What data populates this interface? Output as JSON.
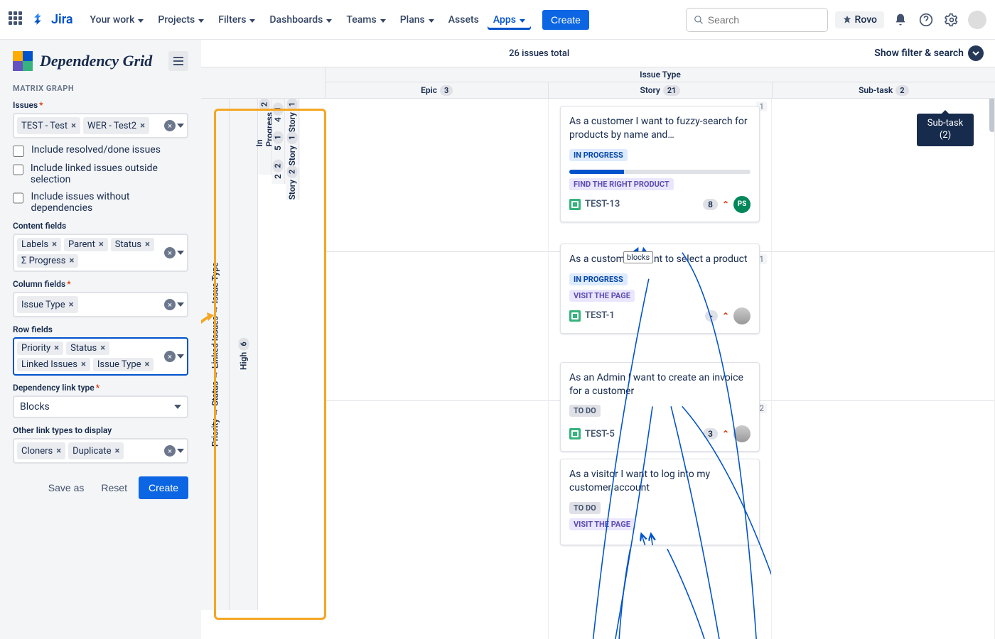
{
  "nav": {
    "logo": "Jira",
    "items": [
      "Your work",
      "Projects",
      "Filters",
      "Dashboards",
      "Teams",
      "Plans",
      "Assets",
      "Apps"
    ],
    "create": "Create",
    "search_placeholder": "Search",
    "rovo": "Rovo"
  },
  "sidebar": {
    "app_title": "Dependency Grid",
    "section": "MATRIX GRAPH",
    "issues_label": "Issues",
    "issues_tags": [
      "TEST - Test",
      "WER - Test2"
    ],
    "chk1": "Include resolved/done issues",
    "chk2": "Include linked issues outside selection",
    "chk3": "Include issues without dependencies",
    "content_label": "Content fields",
    "content_tags": [
      "Labels",
      "Parent",
      "Status",
      "Σ Progress"
    ],
    "col_label": "Column fields",
    "col_tags": [
      "Issue Type"
    ],
    "row_label": "Row fields",
    "row_tags": [
      "Priority",
      "Status",
      "Linked Issues",
      "Issue Type"
    ],
    "dep_label": "Dependency link type",
    "dep_value": "Blocks",
    "other_label": "Other link types to display",
    "other_tags": [
      "Cloners",
      "Duplicate"
    ],
    "save_as": "Save as",
    "reset": "Reset",
    "create": "Create"
  },
  "grid": {
    "total": "26 issues total",
    "filter_toggle": "Show filter & search",
    "col_axis": "Issue Type",
    "columns": [
      {
        "name": "Epic",
        "count": "3"
      },
      {
        "name": "Story",
        "count": "21"
      },
      {
        "name": "Sub-task",
        "count": "2"
      }
    ],
    "row_axis": "Priority → Status → Linked Issues → Issue Type",
    "rows": {
      "priority": {
        "name": "High",
        "count": "6"
      },
      "status": {
        "name": "In Progress",
        "count": "2"
      },
      "cells": [
        {
          "linked": "4",
          "linked_count": "1",
          "type": "Story",
          "type_count": "1"
        },
        {
          "linked": "5",
          "linked_count": "1",
          "type": "Story",
          "type_count": "1"
        },
        {
          "linked": "2",
          "linked_count": "2",
          "type": "Story",
          "type_count": "2"
        }
      ]
    },
    "link_label": "blocks",
    "tooltip": "Sub-task (2)",
    "col_counts": [
      "1",
      "1",
      "2"
    ],
    "cards": [
      {
        "title": "As a customer I want to fuzzy-search for products by name and…",
        "status": "IN PROGRESS",
        "status_class": "",
        "label": "FIND THE RIGHT PRODUCT",
        "key": "TEST-13",
        "pts": "8",
        "avatar": "PS",
        "has_progress": true
      },
      {
        "title": "As a customer I want to select a product",
        "status": "IN PROGRESS",
        "status_class": "",
        "label": "VISIT THE PAGE",
        "key": "TEST-1",
        "pts": "-",
        "avatar": "",
        "has_progress": false
      },
      {
        "title": "As an Admin I want to create an invoice for a customer",
        "status": "TO DO",
        "status_class": "todo",
        "label": "",
        "key": "TEST-5",
        "pts": "3",
        "avatar": "",
        "has_progress": false
      },
      {
        "title": "As a visitor I want to log into my customer account",
        "status": "TO DO",
        "status_class": "todo",
        "label": "VISIT THE PAGE",
        "key": "",
        "pts": "",
        "avatar": "",
        "has_progress": false
      }
    ]
  }
}
